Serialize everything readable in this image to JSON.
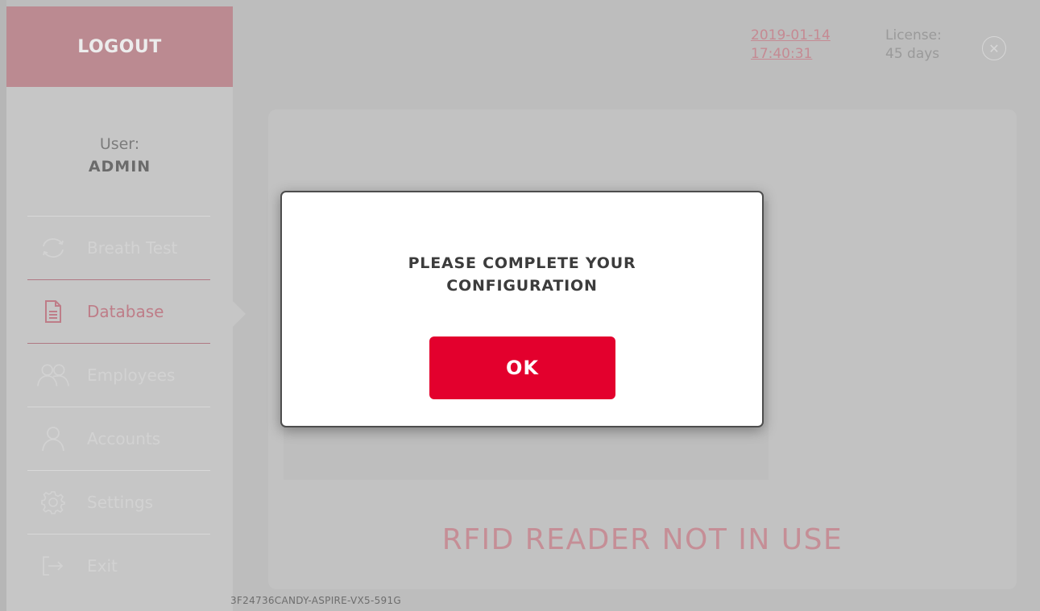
{
  "header": {
    "logout_label": "LOGOUT",
    "date": "2019-01-14",
    "time": "17:40:31",
    "license_label": "License:",
    "license_value": "45 days",
    "close_icon": "close-circle-icon"
  },
  "user": {
    "label": "User:",
    "name": "ADMIN"
  },
  "sidebar": {
    "items": [
      {
        "label": "Breath Test",
        "icon": "refresh-icon"
      },
      {
        "label": "Database",
        "icon": "document-icon",
        "active": true
      },
      {
        "label": "Employees",
        "icon": "group-icon"
      },
      {
        "label": "Accounts",
        "icon": "person-icon"
      },
      {
        "label": "Settings",
        "icon": "gear-icon"
      },
      {
        "label": "Exit",
        "icon": "exit-icon"
      }
    ]
  },
  "main": {
    "rfid_status": "RFID READER NOT IN USE",
    "device_id": "3F24736CANDY-ASPIRE-VX5-591G"
  },
  "dialog": {
    "message_line1": "PLEASE COMPLETE YOUR",
    "message_line2": "CONFIGURATION",
    "ok_label": "OK"
  },
  "colors": {
    "accent": "#e3002d",
    "accent_muted": "#c58a93",
    "overlay_background": "#bdbdbd"
  }
}
